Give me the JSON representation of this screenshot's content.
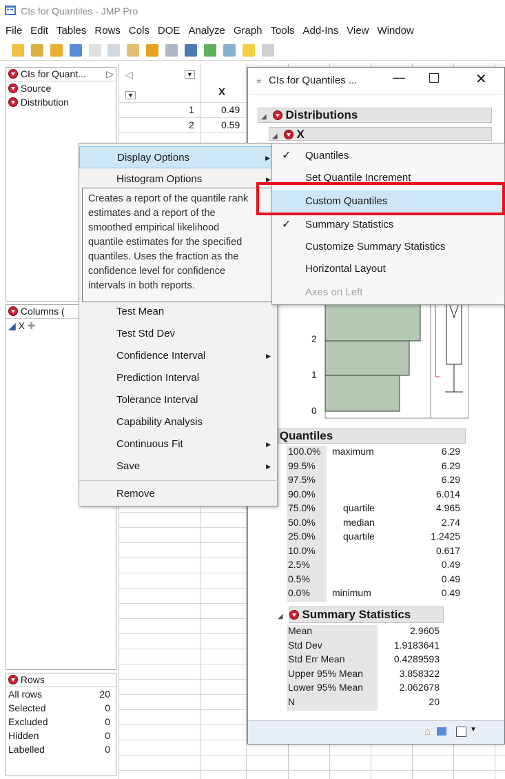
{
  "window": {
    "title": "CIs for Quantiles - JMP Pro"
  },
  "menubar": [
    "File",
    "Edit",
    "Tables",
    "Rows",
    "Cols",
    "DOE",
    "Analyze",
    "Graph",
    "Tools",
    "Add-Ins",
    "View",
    "Window"
  ],
  "table_panel": {
    "title": "CIs for Quant...",
    "items": [
      "Source",
      "Distribution"
    ]
  },
  "columns_panel": {
    "title": "Columns (",
    "items": [
      "X"
    ]
  },
  "rows_panel": {
    "title": "Rows",
    "rows": [
      {
        "label": "All rows",
        "value": "20"
      },
      {
        "label": "Selected",
        "value": "0"
      },
      {
        "label": "Excluded",
        "value": "0"
      },
      {
        "label": "Hidden",
        "value": "0"
      },
      {
        "label": "Labelled",
        "value": "0"
      }
    ]
  },
  "grid": {
    "column_header": "X",
    "rows": [
      {
        "num": "1",
        "x": "0.49"
      },
      {
        "num": "2",
        "x": "0.59"
      }
    ]
  },
  "dist_window": {
    "title": "CIs for Quantiles ...",
    "distributions_label": "Distributions",
    "var_label": "X",
    "axis_ticks": [
      "2",
      "1",
      "0"
    ],
    "quantiles_title": "Quantiles",
    "quantiles": [
      {
        "pct": "100.0%",
        "label": "maximum",
        "value": "6.29"
      },
      {
        "pct": "99.5%",
        "label": "",
        "value": "6.29"
      },
      {
        "pct": "97.5%",
        "label": "",
        "value": "6.29"
      },
      {
        "pct": "90.0%",
        "label": "",
        "value": "6.014"
      },
      {
        "pct": "75.0%",
        "label": "quartile",
        "value": "4.965"
      },
      {
        "pct": "50.0%",
        "label": "median",
        "value": "2.74"
      },
      {
        "pct": "25.0%",
        "label": "quartile",
        "value": "1.2425"
      },
      {
        "pct": "10.0%",
        "label": "",
        "value": "0.617"
      },
      {
        "pct": "2.5%",
        "label": "",
        "value": "0.49"
      },
      {
        "pct": "0.5%",
        "label": "",
        "value": "0.49"
      },
      {
        "pct": "0.0%",
        "label": "minimum",
        "value": "0.49"
      }
    ],
    "summary_title": "Summary Statistics",
    "summary": [
      {
        "label": "Mean",
        "value": "2.9605"
      },
      {
        "label": "Std Dev",
        "value": "1.9183641"
      },
      {
        "label": "Std Err Mean",
        "value": "0.4289593"
      },
      {
        "label": "Upper 95% Mean",
        "value": "3.858322"
      },
      {
        "label": "Lower 95% Mean",
        "value": "2.062678"
      },
      {
        "label": "N",
        "value": "20"
      }
    ]
  },
  "context_menu": {
    "items": [
      {
        "label": "Display Options",
        "submenu": true
      },
      {
        "label": "Histogram Options",
        "submenu": true
      },
      {
        "label": "Test Mean",
        "submenu": false
      },
      {
        "label": "Test Std Dev",
        "submenu": false
      },
      {
        "label": "Confidence Interval",
        "submenu": true
      },
      {
        "label": "Prediction Interval",
        "submenu": false
      },
      {
        "label": "Tolerance Interval",
        "submenu": false
      },
      {
        "label": "Capability Analysis",
        "submenu": false
      },
      {
        "label": "Continuous Fit",
        "submenu": true
      },
      {
        "label": "Save",
        "submenu": true
      },
      {
        "label": "Remove",
        "submenu": false
      }
    ]
  },
  "submenu": {
    "items": [
      {
        "label": "Quantiles",
        "checked": true,
        "disabled": false
      },
      {
        "label": "Set Quantile Increment",
        "checked": false,
        "disabled": false
      },
      {
        "label": "Custom Quantiles",
        "checked": false,
        "disabled": false
      },
      {
        "label": "Summary Statistics",
        "checked": true,
        "disabled": false
      },
      {
        "label": "Customize Summary Statistics",
        "checked": false,
        "disabled": false
      },
      {
        "label": "Horizontal Layout",
        "checked": false,
        "disabled": false
      },
      {
        "label": "Axes on Left",
        "checked": false,
        "disabled": true
      }
    ]
  },
  "tooltip": {
    "lines": [
      "Creates a report of the quantile rank",
      "estimates and a report of the",
      "smoothed empirical likelihood",
      "quantile estimates for the specified",
      "quantiles. Uses the fraction as the",
      "confidence level for confidence",
      "intervals in both reports."
    ]
  },
  "colors": {
    "accent_red": "#e8101e",
    "highlight_blue": "#cde6f7",
    "histogram_fill": "#b4c8b4"
  }
}
